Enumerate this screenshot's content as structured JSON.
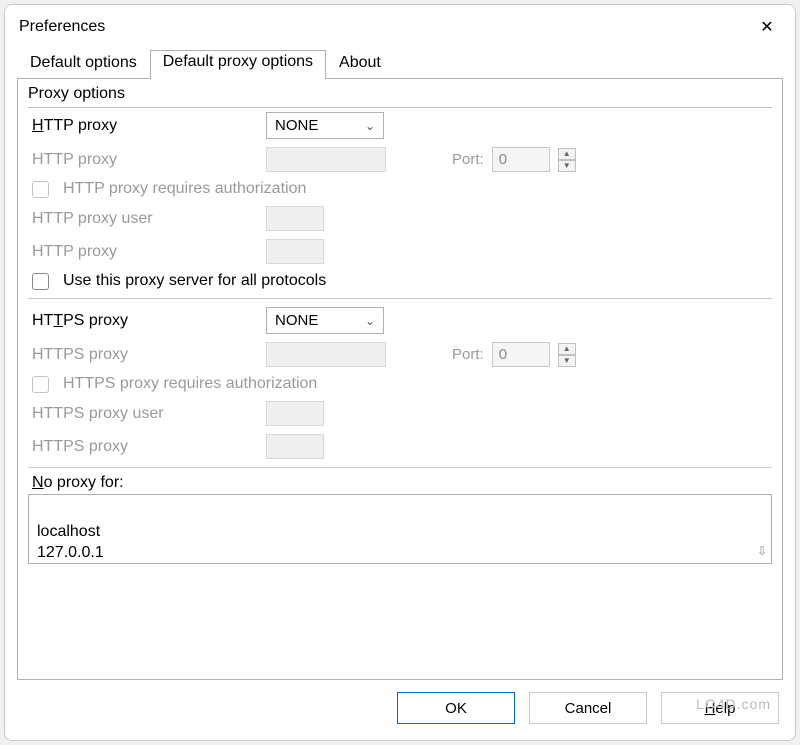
{
  "window": {
    "title": "Preferences"
  },
  "tabs": [
    {
      "label": "Default options"
    },
    {
      "label": "Default proxy options"
    },
    {
      "label": "About"
    }
  ],
  "group": {
    "title": "Proxy options"
  },
  "http": {
    "label_main_pre": "H",
    "label_main_post": "TTP proxy",
    "select_value": "NONE",
    "label_host": "HTTP proxy",
    "port_label": "Port:",
    "port_value": "0",
    "auth_label": "HTTP proxy requires authorization",
    "user_label": "HTTP proxy user",
    "pass_label": "HTTP proxy"
  },
  "useall": {
    "label": "Use this proxy server for all protocols"
  },
  "https": {
    "label_main_pre": "HT",
    "label_main_mid": "T",
    "label_main_post": "PS proxy",
    "select_value": "NONE",
    "label_host": "HTTPS proxy",
    "port_label": "Port:",
    "port_value": "0",
    "auth_label": "HTTPS proxy requires authorization",
    "user_label": "HTTPS proxy user",
    "pass_label": "HTTPS proxy"
  },
  "noproxy": {
    "label_pre": "N",
    "label_mid": "o",
    "label_post": " proxy for:",
    "value": "localhost\n127.0.0.1"
  },
  "buttons": {
    "ok": "OK",
    "cancel": "Cancel",
    "help_pre": "",
    "help_mid": "H",
    "help_post": "elp"
  },
  "watermark": "LO4D.com"
}
